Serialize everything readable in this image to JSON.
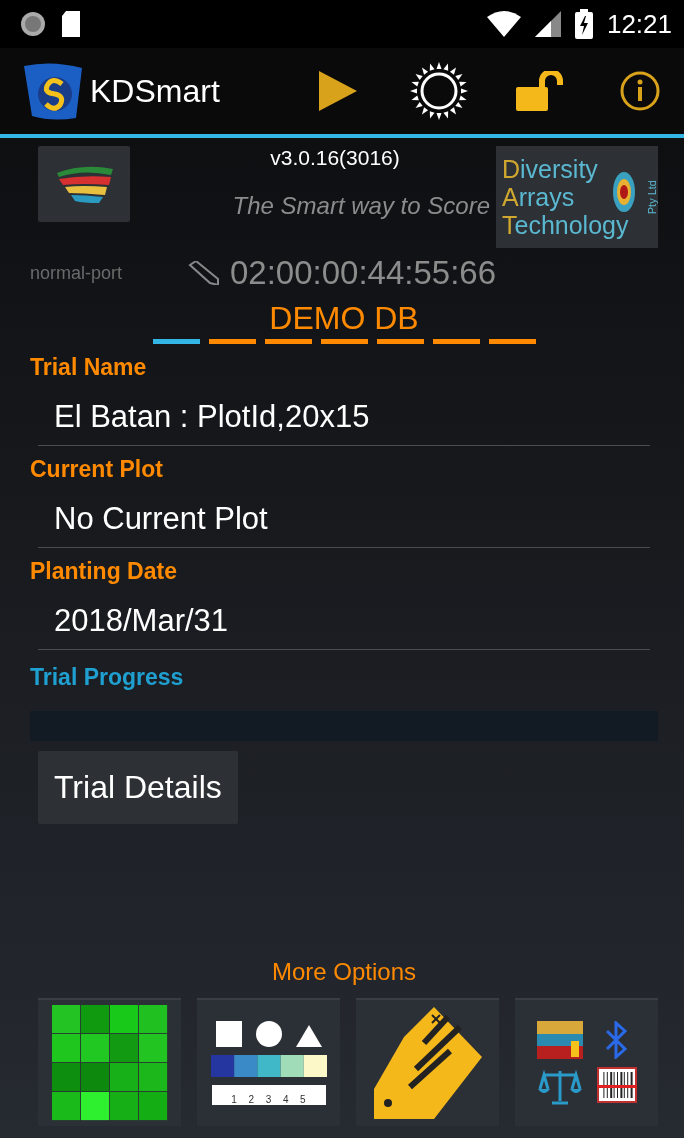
{
  "status_bar": {
    "time": "12:21"
  },
  "app_bar": {
    "title": "KDSmart"
  },
  "header": {
    "version": "v3.0.16(3016)",
    "tagline": "The Smart way to Score",
    "layout_label": "normal-port",
    "timer": "02:00:00:44:55:66",
    "dart_logo_lines": [
      {
        "initial": "D",
        "rest": "iversity"
      },
      {
        "initial": "A",
        "rest": "rrays"
      },
      {
        "initial": "T",
        "rest": "echnology"
      }
    ],
    "dart_logo_suffix": "Pty Ltd"
  },
  "database": {
    "name": "DEMO DB",
    "pages": [
      {
        "selected": true
      },
      {
        "selected": false
      },
      {
        "selected": false
      },
      {
        "selected": false
      },
      {
        "selected": false
      },
      {
        "selected": false
      },
      {
        "selected": false
      }
    ]
  },
  "fields": [
    {
      "label": "Trial Name",
      "value": "El Batan : PlotId,20x15"
    },
    {
      "label": "Current Plot",
      "value": "No Current Plot"
    },
    {
      "label": "Planting Date",
      "value": "2018/Mar/31"
    }
  ],
  "progress": {
    "label": "Trial Progress",
    "level": 0
  },
  "trial_details_button": "Trial Details",
  "more_options": {
    "title": "More Options",
    "ruler_labels": [
      "1",
      "2",
      "3",
      "4",
      "5"
    ]
  }
}
